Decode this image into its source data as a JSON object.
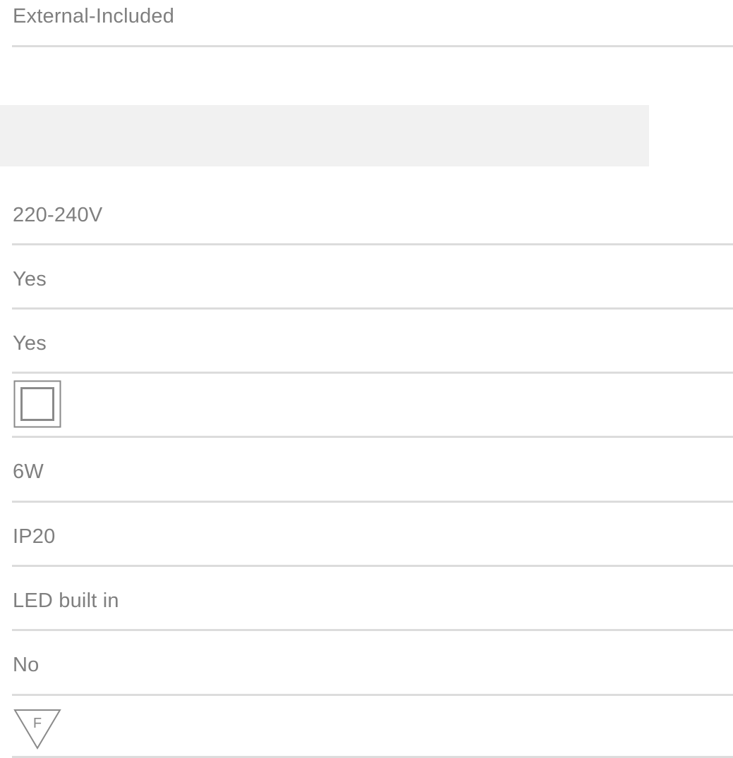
{
  "spec_rows": [
    {
      "id": "power-supply",
      "value": "External-Included"
    },
    {
      "id": "voltage",
      "value": "220-240V"
    },
    {
      "id": "dimmable",
      "value": "Yes"
    },
    {
      "id": "driver",
      "value": "Yes"
    },
    {
      "id": "insulation-class",
      "icon": "class-ii-double-square-icon"
    },
    {
      "id": "wattage",
      "value": "6W"
    },
    {
      "id": "ip-rating",
      "value": "IP20"
    },
    {
      "id": "lamp-type",
      "value": "LED built in"
    },
    {
      "id": "bulb-replaceable",
      "value": "No"
    },
    {
      "id": "mounting-mark",
      "icon": "f-triangle-icon",
      "icon_letter": "F"
    }
  ]
}
